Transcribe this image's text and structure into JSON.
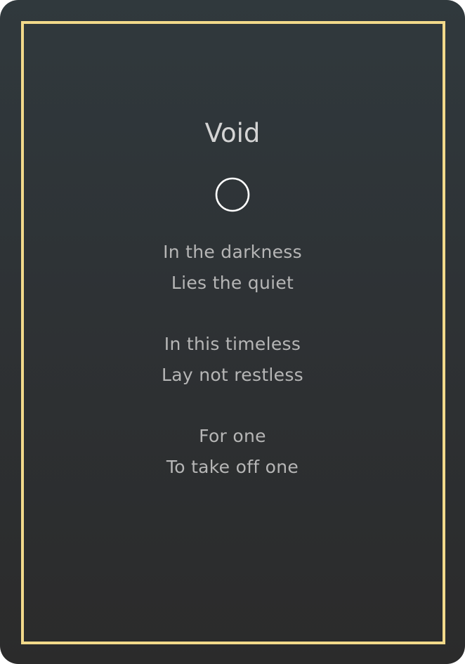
{
  "card": {
    "title": "Void",
    "emblem_icon": "hollow-circle-icon",
    "stanzas": [
      {
        "lines": [
          "In the darkness",
          "Lies the quiet"
        ]
      },
      {
        "lines": [
          "In this timeless",
          "Lay not restless"
        ]
      },
      {
        "lines": [
          "For one",
          "To take off one"
        ]
      }
    ]
  },
  "colors": {
    "background_top": "#30393d",
    "background_bottom": "#2b2b2b",
    "border": "#f2d98a",
    "title": "#d4d4d4",
    "text": "#b6b6b6",
    "emblem": "#ffffff"
  }
}
